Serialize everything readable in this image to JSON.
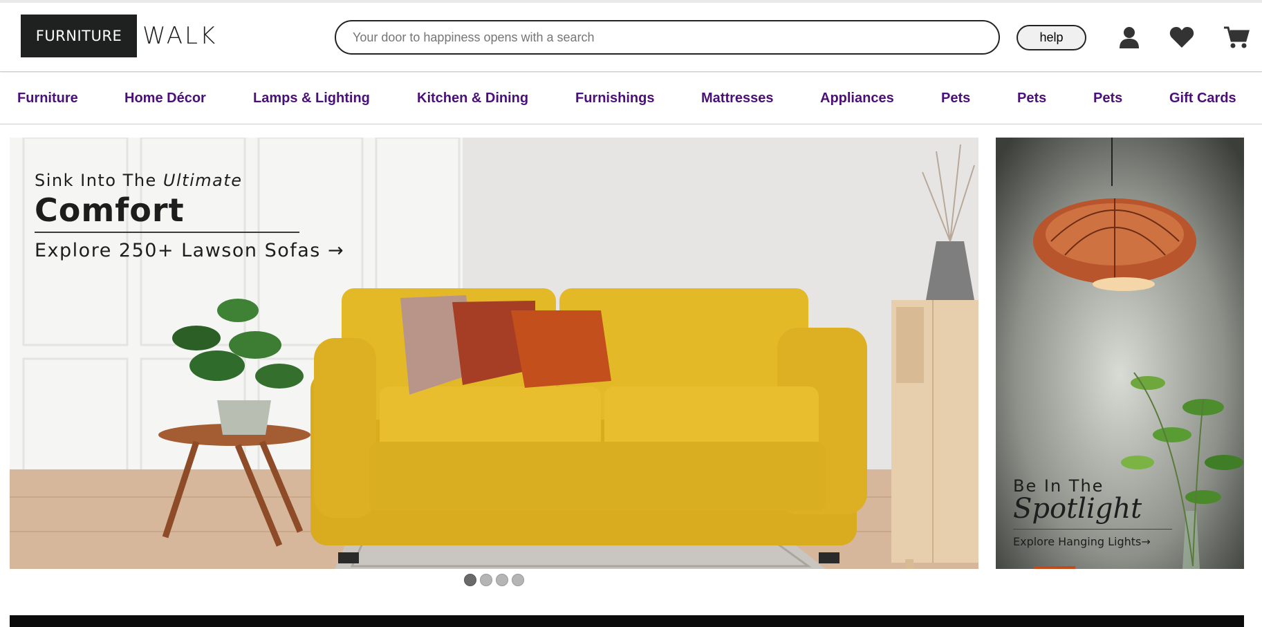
{
  "header": {
    "logo_box_text": "FURNITURE",
    "logo_word": "WALK",
    "search_placeholder": "Your door to happiness opens with a search",
    "help_label": "help",
    "icons": [
      "user-icon",
      "heart-icon",
      "cart-icon"
    ]
  },
  "nav": {
    "items": [
      {
        "label": "Furniture"
      },
      {
        "label": "Home Décor"
      },
      {
        "label": "Lamps & Lighting"
      },
      {
        "label": "Kitchen & Dining"
      },
      {
        "label": "Furnishings"
      },
      {
        "label": "Mattresses"
      },
      {
        "label": "Appliances"
      },
      {
        "label": "Pets"
      },
      {
        "label": "Pets"
      },
      {
        "label": "Pets"
      },
      {
        "label": "Gift Cards"
      }
    ]
  },
  "hero": {
    "line1_prefix": "Sink Into The ",
    "line1_italic": "Ultimate",
    "line2": "Comfort",
    "line3": "Explore 250+ Lawson Sofas →"
  },
  "side_banner": {
    "line1": "Be In The",
    "line2": "Spotlight",
    "line3": "Explore Hanging Lights→"
  },
  "carousel": {
    "slide_count": 4,
    "active_index": 0
  },
  "colors": {
    "nav_text": "#4b0f78",
    "sofa_yellow": "#e3b72a",
    "logo_bg": "#1f2120"
  }
}
